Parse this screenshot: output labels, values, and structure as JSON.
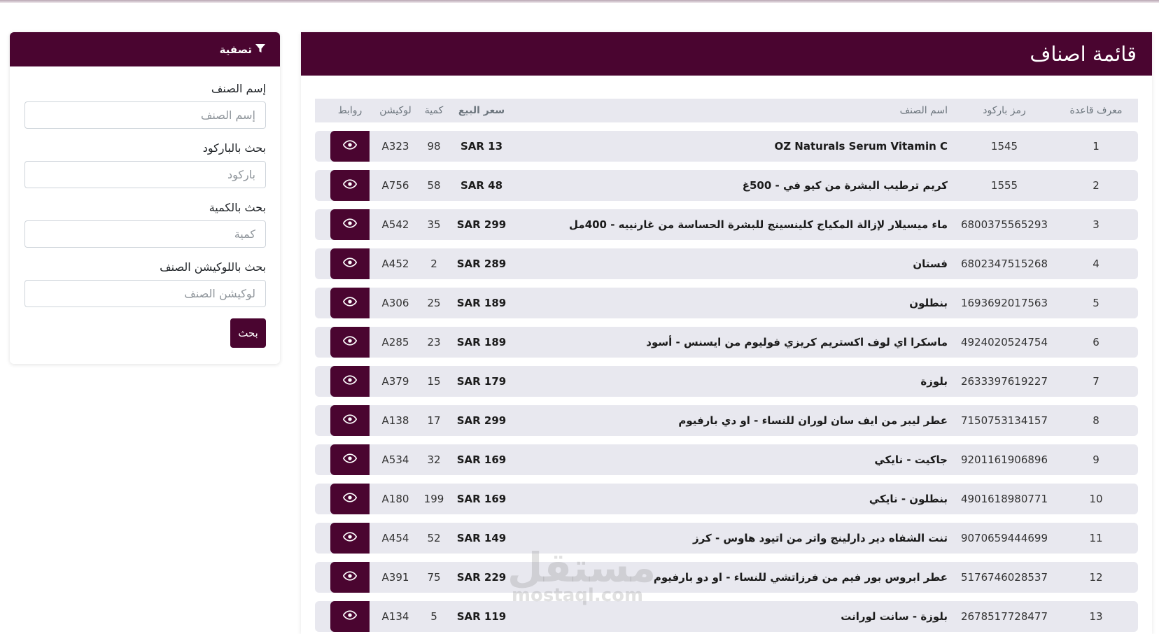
{
  "list": {
    "title": "قائمة اصناف",
    "columns": {
      "id": "معرف قاعدة",
      "barcode": "رمز باركود",
      "name": "اسم الصنف",
      "price": "سعر البيع",
      "qty": "كمية",
      "location": "لوكيشن",
      "links": "روابط"
    },
    "rows": [
      {
        "id": "1",
        "barcode": "1545",
        "name": "OZ Naturals Serum Vitamin C",
        "price": "SAR 13",
        "qty": "98",
        "location": "A323"
      },
      {
        "id": "2",
        "barcode": "1555",
        "name": "كريم ترطيب البشرة من كيو في - 500غ",
        "price": "SAR 48",
        "qty": "58",
        "location": "A756"
      },
      {
        "id": "3",
        "barcode": "6800375565293",
        "name": "ماء ميسيلار لإزالة المكياج كلينسينج للبشرة الحساسة من غارنييه - 400مل",
        "price": "SAR 299",
        "qty": "35",
        "location": "A542"
      },
      {
        "id": "4",
        "barcode": "6802347515268",
        "name": "فستان",
        "price": "SAR 289",
        "qty": "2",
        "location": "A452"
      },
      {
        "id": "5",
        "barcode": "1693692017563",
        "name": "بنطلون",
        "price": "SAR 189",
        "qty": "25",
        "location": "A306"
      },
      {
        "id": "6",
        "barcode": "4924020524754",
        "name": "ماسكرا اي لوف اكستريم كريزي فوليوم من ايسنس - أسود",
        "price": "SAR 189",
        "qty": "23",
        "location": "A285"
      },
      {
        "id": "7",
        "barcode": "2633397619227",
        "name": "بلوزة",
        "price": "SAR 179",
        "qty": "15",
        "location": "A379"
      },
      {
        "id": "8",
        "barcode": "7150753134157",
        "name": "عطر ليبر من ايف سان لوران للنساء - او دي بارفيوم",
        "price": "SAR 299",
        "qty": "17",
        "location": "A138"
      },
      {
        "id": "9",
        "barcode": "9201161906896",
        "name": "جاكيت - نايكي",
        "price": "SAR 169",
        "qty": "32",
        "location": "A534"
      },
      {
        "id": "10",
        "barcode": "4901618980771",
        "name": "بنطلون - نايكي",
        "price": "SAR 169",
        "qty": "199",
        "location": "A180"
      },
      {
        "id": "11",
        "barcode": "9070659444699",
        "name": "تنت الشفاه دير دارلينج واتر من اتيود هاوس - كرز",
        "price": "SAR 149",
        "qty": "52",
        "location": "A454"
      },
      {
        "id": "12",
        "barcode": "5176746028537",
        "name": "عطر ابروس بور فيم من فرزاتشي للنساء - او دو بارفيوم",
        "price": "SAR 229",
        "qty": "75",
        "location": "A391"
      },
      {
        "id": "13",
        "barcode": "2678517728477",
        "name": "بلوزة - سانت لورانت",
        "price": "SAR 119",
        "qty": "5",
        "location": "A134"
      }
    ]
  },
  "filter": {
    "title": "تصفية",
    "fields": [
      {
        "label": "إسم الصنف",
        "placeholder": "إسم الصنف"
      },
      {
        "label": "بحث بالباركود",
        "placeholder": "باركود"
      },
      {
        "label": "بحث بالكمية",
        "placeholder": "كمية"
      },
      {
        "label": "بحث باللوكيشن الصنف",
        "placeholder": "لوكيشن الصنف"
      }
    ],
    "search_label": "بحث"
  },
  "watermark": {
    "ar": "مستقل",
    "en": "mostaql.com"
  },
  "colors": {
    "brand": "#4a0530",
    "row_bg": "#e8e8ef"
  }
}
